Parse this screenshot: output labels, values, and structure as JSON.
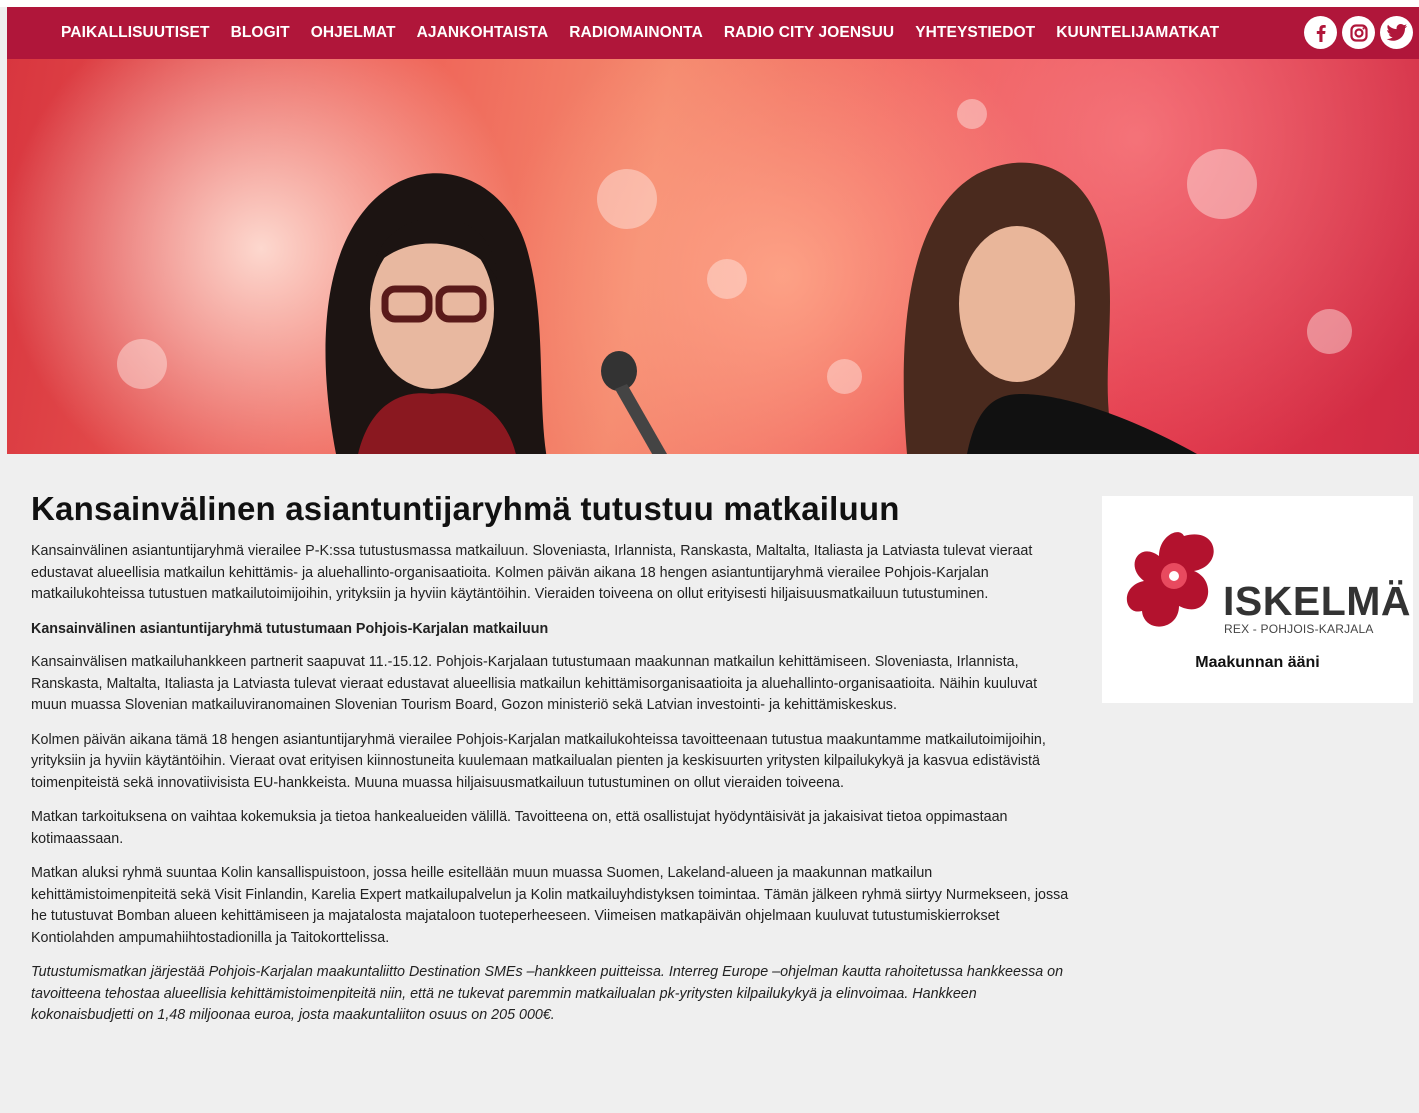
{
  "nav": {
    "items": [
      {
        "label": "PAIKALLISUUTISET"
      },
      {
        "label": "BLOGIT"
      },
      {
        "label": "OHJELMAT"
      },
      {
        "label": "AJANKOHTAISTA"
      },
      {
        "label": "RADIOMAINONTA"
      },
      {
        "label": "RADIO CITY JOENSUU"
      },
      {
        "label": "YHTEYSTIEDOT"
      },
      {
        "label": "KUUNTELIJAMATKAT"
      }
    ],
    "social": [
      "facebook-icon",
      "instagram-icon",
      "twitter-icon"
    ],
    "color": "#b0163a"
  },
  "article": {
    "title": "Kansainvälinen asiantuntijaryhmä tutustuu matkailuun",
    "intro": "Kansainvälinen asiantuntijaryhmä vierailee P-K:ssa tutustusmassa matkailuun. Sloveniasta, Irlannista, Ranskasta, Maltalta, Italiasta ja Latviasta tulevat vieraat edustavat alueellisia matkailun kehittämis- ja aluehallinto-organisaatioita. Kolmen päivän aikana 18 hengen asiantuntijaryhmä vierailee Pohjois-Karjalan matkailukohteissa tutustuen matkailutoimijoihin, yrityksiin ja hyviin käytäntöihin. Vieraiden toiveena on ollut erityisesti hiljaisuusmatkailuun tutustuminen.",
    "subheading": "Kansainvälinen asiantuntijaryhmä tutustumaan Pohjois-Karjalan matkailuun",
    "p1": "Kansainvälisen matkailuhankkeen partnerit saapuvat 11.-15.12. Pohjois-Karjalaan tutustumaan maakunnan matkailun kehittämiseen. Sloveniasta, Irlannista, Ranskasta, Maltalta, Italiasta ja Latviasta tulevat vieraat edustavat alueellisia matkailun kehittämisorganisaatioita ja aluehallinto-organisaatioita. Näihin kuuluvat muun muassa Slovenian matkailuviranomainen Slovenian Tourism Board, Gozon ministeriö sekä Latvian investointi- ja kehittämiskeskus.",
    "p2": "Kolmen päivän aikana tämä 18 hengen asiantuntijaryhmä vierailee Pohjois-Karjalan matkailukohteissa tavoitteenaan tutustua maakuntamme matkailutoimijoihin, yrityksiin ja hyviin käytäntöihin. Vieraat ovat erityisen kiinnostuneita kuulemaan matkailualan pienten ja keskisuurten yritysten kilpailukykyä ja kasvua edistävistä toimenpiteistä sekä innovatiivisista EU-hankkeista. Muuna muassa hiljaisuusmatkailuun tutustuminen on ollut vieraiden toiveena.",
    "p3": "Matkan tarkoituksena on vaihtaa kokemuksia ja tietoa hankealueiden välillä. Tavoitteena on, että osallistujat hyödyntäisivät ja jakaisivat tietoa oppimastaan kotimaassaan.",
    "p4": "Matkan aluksi ryhmä suuntaa Kolin kansallispuistoon, jossa heille esitellään muun muassa Suomen, Lakeland-alueen ja maakunnan matkailun kehittämistoimenpiteitä sekä Visit Finlandin, Karelia Expert matkailupalvelun ja Kolin matkailuyhdistyksen toimintaa. Tämän jälkeen ryhmä siirtyy Nurmekseen, jossa he tutustuvat Bomban alueen kehittämiseen ja majatalosta majataloon tuoteperheeseen. Viimeisen matkapäivän ohjelmaan kuuluvat tutustumiskierrokset Kontiolahden ampumahiihtostadionilla ja Taitokorttelissa.",
    "p5": "Tutustumismatkan järjestää Pohjois-Karjalan maakuntaliitto Destination SMEs –hankkeen puitteissa. Interreg Europe –ohjelman kautta rahoitetussa hankkeessa on tavoitteena tehostaa alueellisia kehittämistoimenpiteitä niin, että ne tukevat paremmin matkailualan pk-yritysten kilpailukykyä ja elinvoimaa. Hankkeen kokonaisbudjetti on 1,48 miljoonaa euroa, josta maakuntaliiton osuus on 205 000€."
  },
  "sidebar": {
    "logo_word": "ISKELMÄ",
    "logo_sub": "REX - POHJOIS-KARJALA",
    "tagline": "Maakunnan ääni"
  }
}
